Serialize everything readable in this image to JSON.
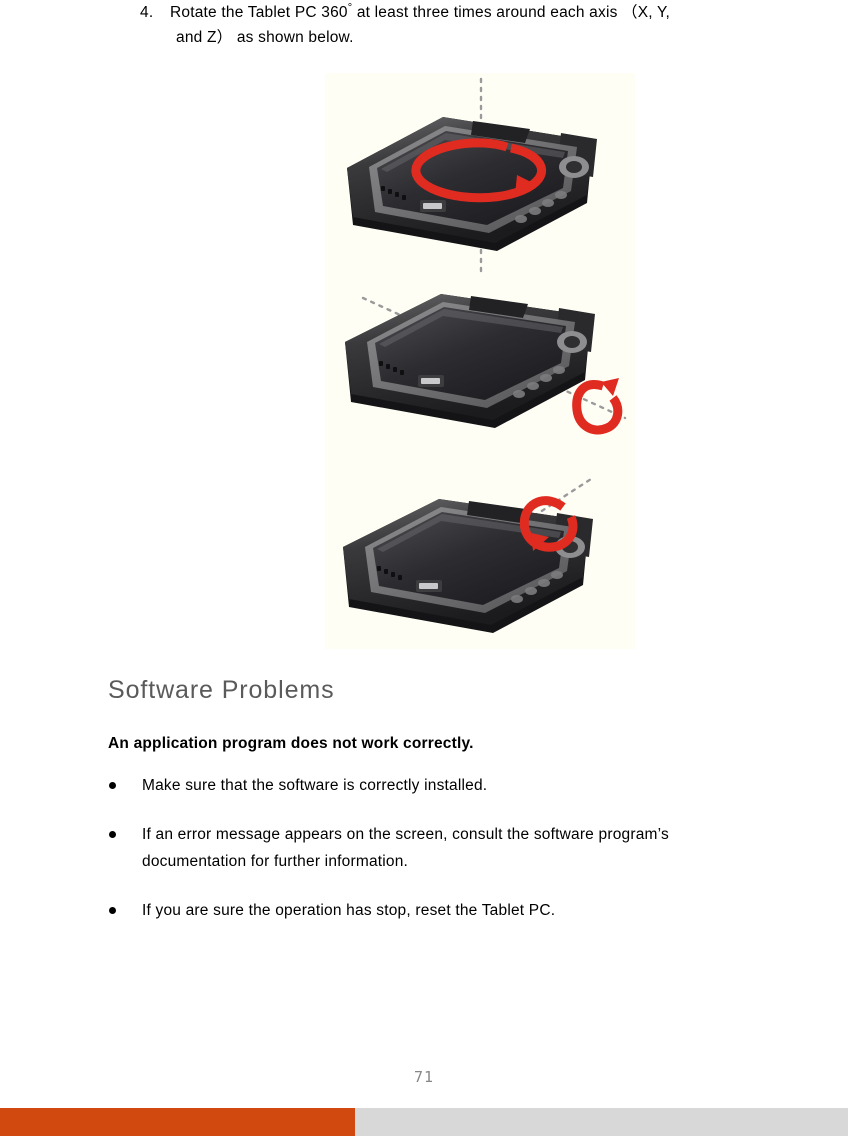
{
  "document": {
    "page_number": "71"
  },
  "step": {
    "number": "4.",
    "line1_before_degree": "Rotate  the  Tablet  PC  360",
    "degree_symbol": "°",
    "line1_after_degree": "  at  least  three  times  around  each  axis  （X,  Y,",
    "line2": "and  Z）  as  shown  below."
  },
  "figure": {
    "caption_alt": "Tablet PC rotation around X, Y and Z axes",
    "arrow_color": "#E02B20",
    "axis_line_color": "#8C8C8C",
    "background": "#FFFEF5",
    "panels": [
      {
        "name": "rotate-z-axis",
        "axis": "Z",
        "axis_orientation": "vertical"
      },
      {
        "name": "rotate-x-axis",
        "axis": "X",
        "axis_orientation": "diagonal-down-right"
      },
      {
        "name": "rotate-y-axis",
        "axis": "Y",
        "axis_orientation": "diagonal-up-right"
      }
    ]
  },
  "section": {
    "heading": "Software Problems",
    "heading_color": "#5A5A5A",
    "subheading": "An application program does not work correctly."
  },
  "bullets": [
    {
      "id": "bullet-make-sure-installed",
      "lines": [
        "Make  sure  that  the  software  is  correctly  installed."
      ]
    },
    {
      "id": "bullet-error-message",
      "lines": [
        "If  an  error  message  appears  on  the  screen,  consult  the  software  program’s",
        "documentation  for  further  information."
      ]
    },
    {
      "id": "bullet-reset-tablet",
      "lines": [
        "If  you  are  sure  the  operation  has  stop,  reset  the  Tablet  PC."
      ]
    }
  ],
  "footer": {
    "orange_color": "#D2490F",
    "gray_color": "#D8D8D8"
  }
}
